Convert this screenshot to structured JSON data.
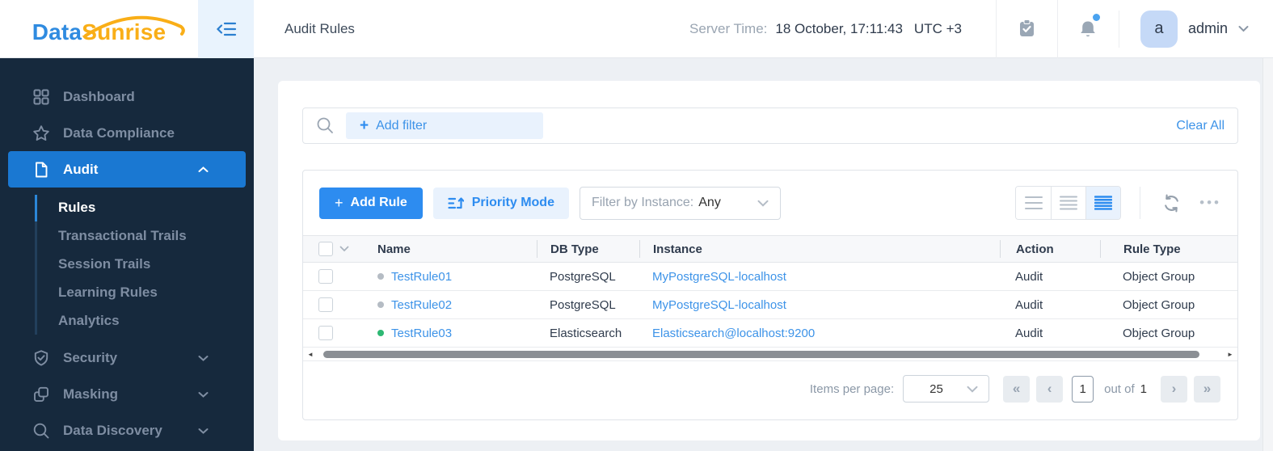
{
  "brand": {
    "part1": "Data",
    "part2": "Sunrise"
  },
  "topbar": {
    "page_title": "Audit Rules",
    "server_time": {
      "label": "Server Time:",
      "datetime": "18 October, 17:11:43",
      "timezone": "UTC +3"
    },
    "user": {
      "initial": "a",
      "name": "admin"
    }
  },
  "sidebar": {
    "items": [
      {
        "label": "Dashboard",
        "icon": "grid-icon",
        "active": false
      },
      {
        "label": "Data Compliance",
        "icon": "star-icon",
        "active": false
      },
      {
        "label": "Audit",
        "icon": "document-icon",
        "active": true,
        "expanded": true
      },
      {
        "label": "Security",
        "icon": "shield-icon",
        "active": false
      },
      {
        "label": "Masking",
        "icon": "mask-icon",
        "active": false
      },
      {
        "label": "Data Discovery",
        "icon": "search-icon",
        "active": false
      }
    ],
    "audit_submenu": [
      {
        "label": "Rules",
        "active": true
      },
      {
        "label": "Transactional Trails",
        "active": false
      },
      {
        "label": "Session Trails",
        "active": false
      },
      {
        "label": "Learning Rules",
        "active": false
      },
      {
        "label": "Analytics",
        "active": false
      }
    ]
  },
  "filter_bar": {
    "add_filter": "Add filter",
    "clear_all": "Clear All"
  },
  "toolbar": {
    "add_rule": "Add Rule",
    "priority_mode": "Priority Mode",
    "instance_filter_label": "Filter by Instance:",
    "instance_filter_value": "Any"
  },
  "table": {
    "columns": {
      "name": "Name",
      "db_type": "DB Type",
      "instance": "Instance",
      "action": "Action",
      "rule_type": "Rule Type"
    },
    "rows": [
      {
        "status": "gray",
        "name": "TestRule01",
        "db_type": "PostgreSQL",
        "instance": "MyPostgreSQL-localhost",
        "action": "Audit",
        "rule_type": "Object Group"
      },
      {
        "status": "gray",
        "name": "TestRule02",
        "db_type": "PostgreSQL",
        "instance": "MyPostgreSQL-localhost",
        "action": "Audit",
        "rule_type": "Object Group"
      },
      {
        "status": "green",
        "name": "TestRule03",
        "db_type": "Elasticsearch",
        "instance": "Elasticsearch@localhost:9200",
        "action": "Audit",
        "rule_type": "Object Group"
      }
    ]
  },
  "pagination": {
    "items_per_page_label": "Items per page:",
    "page_size": "25",
    "current_page": "1",
    "out_of_label": "out of",
    "total_pages": "1"
  },
  "glyphs": {
    "plus": "+",
    "ellipsis": "•••",
    "first": "«",
    "prev": "‹",
    "next": "›",
    "last": "»",
    "scroll_left": "◄",
    "scroll_right": "►"
  },
  "colors": {
    "accent": "#2d8cf0",
    "link": "#3d93e8",
    "sidebar_bg": "#16293d",
    "active_item": "#1a78d2",
    "status_gray": "#b5bcc4",
    "status_green": "#2eb873",
    "brand_blue": "#2f8be0",
    "brand_orange": "#f9ae17"
  }
}
